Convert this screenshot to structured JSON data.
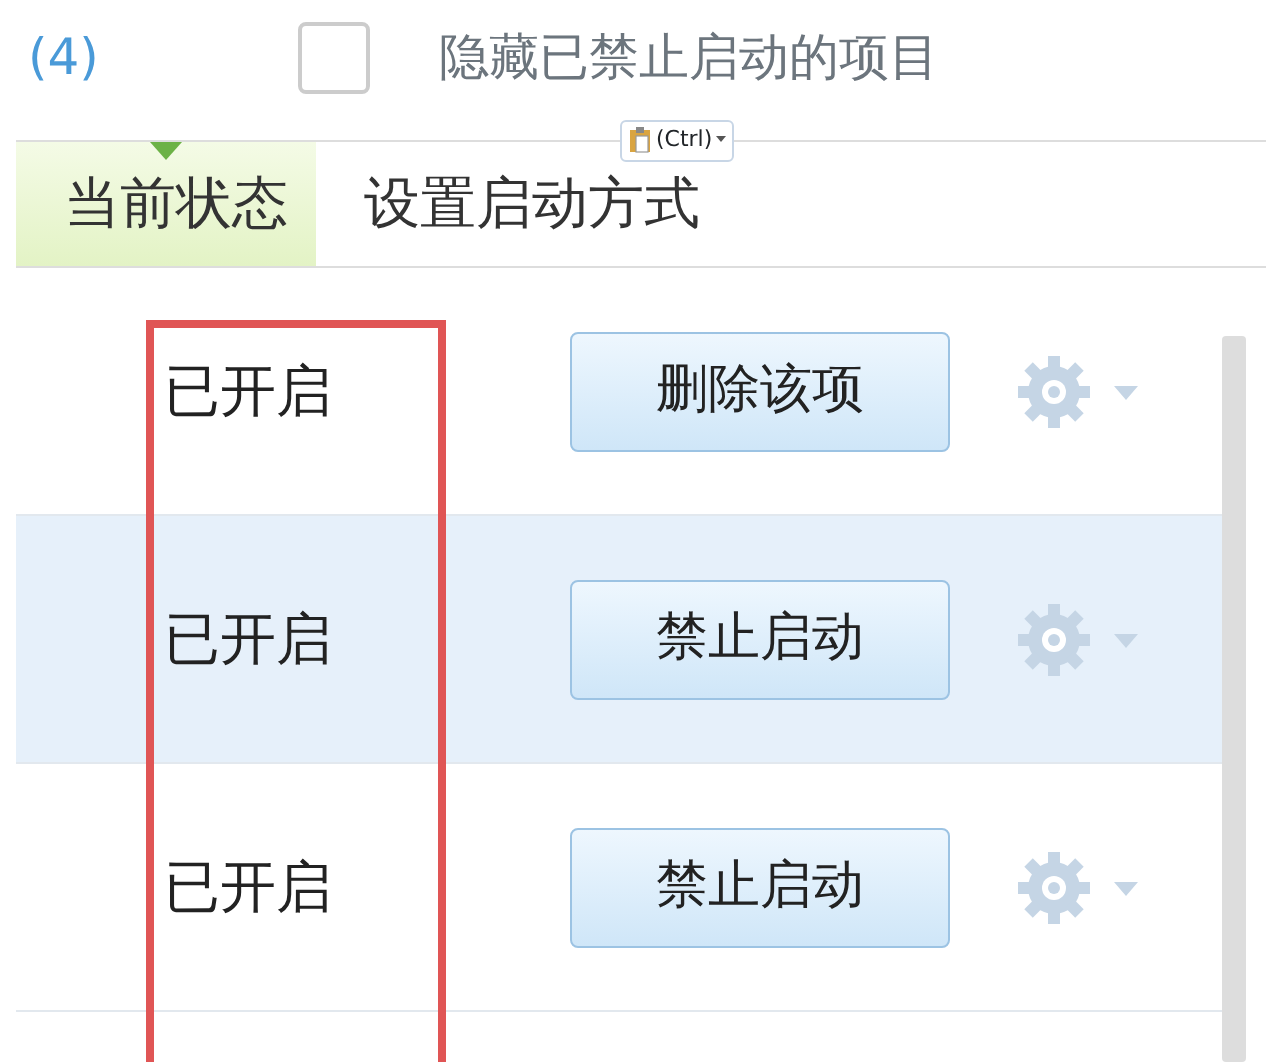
{
  "toolbar": {
    "count_link": "(4)",
    "hide_disabled": {
      "label": "隐藏已禁止启动的项目",
      "checked": false
    }
  },
  "paste_tag": {
    "label": "(Ctrl)"
  },
  "columns": [
    {
      "label": "当前状态",
      "selected": true
    },
    {
      "label": "设置启动方式",
      "selected": false
    }
  ],
  "rows": [
    {
      "status": "已开启",
      "action": "删除该项",
      "highlighted": false
    },
    {
      "status": "已开启",
      "action": "禁止启动",
      "highlighted": true
    },
    {
      "status": "已开启",
      "action": "禁止启动",
      "highlighted": false
    }
  ]
}
